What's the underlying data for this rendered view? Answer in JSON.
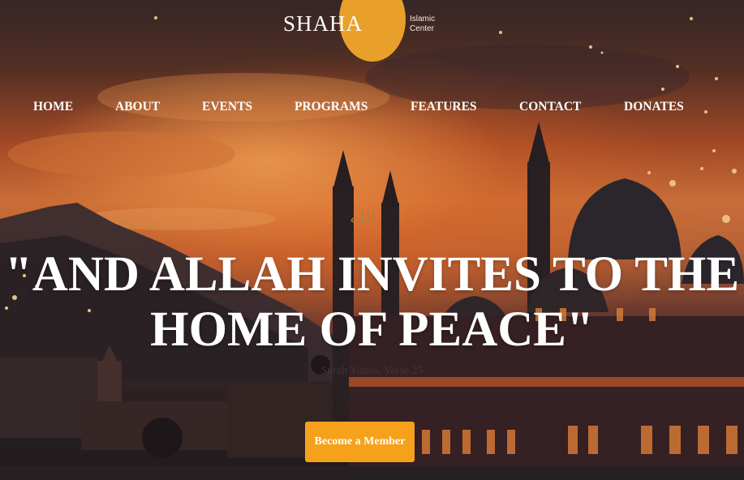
{
  "brand": {
    "name": "SHAHA",
    "subtitle_line1": "Islamic",
    "subtitle_line2": "Center"
  },
  "nav": {
    "items": [
      "HOME",
      "ABOUT",
      "EVENTS",
      "PROGRAMS",
      "FEATURES",
      "CONTACT",
      "DONATES"
    ]
  },
  "hero": {
    "calligraphy": "الله",
    "quote_line1": "\"AND ALLAH INVITES TO THE",
    "quote_line2": "HOME OF PEACE\"",
    "citation": "Surah Yunus, Verse 25",
    "cta_label": "Become a Member"
  },
  "colors": {
    "accent": "#f5a11c",
    "logo_circle": "#e9a02a",
    "text": "#ffffff"
  }
}
